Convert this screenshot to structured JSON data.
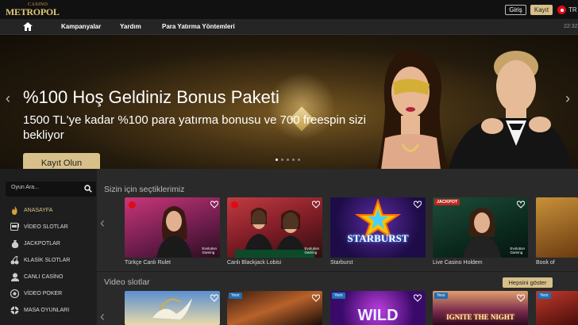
{
  "header": {
    "logo_small": "CASINO",
    "logo_big": "METROPOL",
    "login_label": "Giriş",
    "register_label": "Kayıt",
    "language": "TR"
  },
  "nav": {
    "items": [
      {
        "label": "Kampanyalar"
      },
      {
        "label": "Yardım"
      },
      {
        "label": "Para Yatırma Yöntemleri"
      }
    ],
    "time": "22:32"
  },
  "hero": {
    "title": "%100 Hoş Geldiniz Bonus Paketi",
    "subtitle": "1500 TL'ye kadar %100 para yatırma bonusu ve 700 freespin sizi bekliyor",
    "cta_label": "Kayıt Olun",
    "slide_count": 5,
    "active_slide": 1
  },
  "sidebar": {
    "search_placeholder": "Oyun Ara...",
    "items": [
      {
        "label": "ANASAYFA",
        "icon": "flame-icon",
        "active": true
      },
      {
        "label": "VİDEO SLOTLAR",
        "icon": "slot-machine-icon"
      },
      {
        "label": "JACKPOTLAR",
        "icon": "money-bag-icon"
      },
      {
        "label": "KLASİK SLOTLAR",
        "icon": "cherries-icon"
      },
      {
        "label": "CANLI CASİNO",
        "icon": "dealer-icon"
      },
      {
        "label": "VİDEO POKER",
        "icon": "poker-chip-icon"
      },
      {
        "label": "MASA OYUNLARI",
        "icon": "roulette-icon"
      }
    ]
  },
  "sections": [
    {
      "title": "Sizin için seçtiklerimiz",
      "games": [
        {
          "label": "Türkçe Canlı Rulet",
          "provider": "Evolution Gaming"
        },
        {
          "label": "Canlı Blackjack Lobisi",
          "provider": "Evolution Gaming"
        },
        {
          "label": "Starburst",
          "logo": "STARBURST"
        },
        {
          "label": "Live Casino Holdem",
          "provider": "Evolution Gaming",
          "badge": "JACKPOT"
        },
        {
          "label": "Book of"
        }
      ]
    },
    {
      "title": "Video slotlar",
      "show_all_label": "Hepsini göster",
      "games": [
        {
          "label": ""
        },
        {
          "label": "",
          "badge": "Yeni"
        },
        {
          "label": "",
          "badge": "Yeni",
          "logo": "WILD"
        },
        {
          "label": "",
          "badge": "Yeni",
          "logo": "IGNITE THE NIGHT"
        },
        {
          "label": "",
          "badge": "Yeni"
        }
      ]
    }
  ]
}
